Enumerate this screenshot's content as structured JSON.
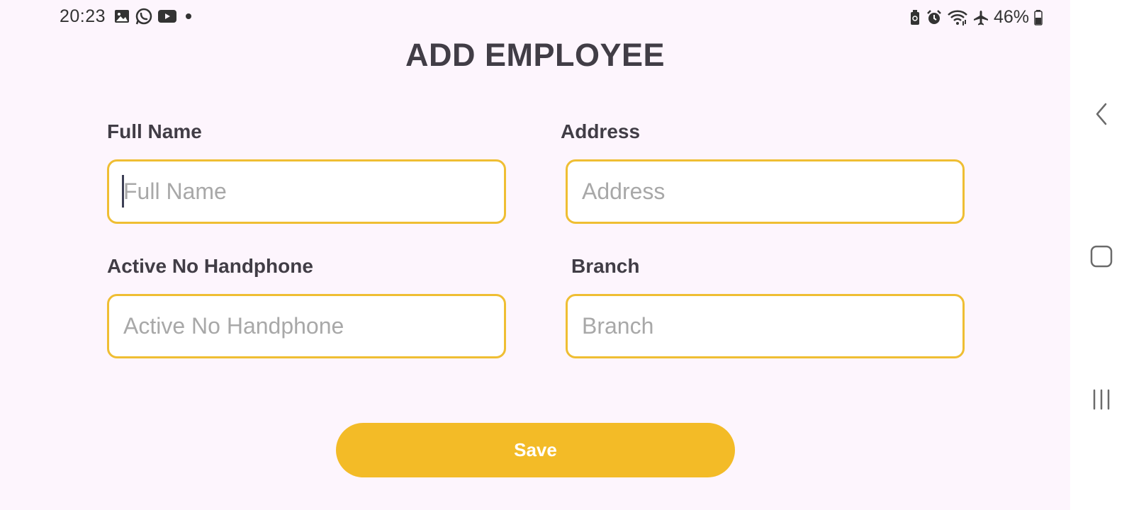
{
  "status_bar": {
    "time": "20:23",
    "left_icons": [
      "image-icon",
      "whatsapp-icon",
      "youtube-icon",
      "dot-icon"
    ],
    "right_icons": [
      "battery-saver-icon",
      "alarm-icon",
      "wifi-icon",
      "airplane-icon"
    ],
    "battery_percent": "46%"
  },
  "page": {
    "title": "ADD EMPLOYEE"
  },
  "form": {
    "full_name": {
      "label": "Full Name",
      "placeholder": "Full Name",
      "value": ""
    },
    "address": {
      "label": "Address",
      "placeholder": "Address",
      "value": ""
    },
    "phone": {
      "label": "Active No Handphone",
      "placeholder": "Active No Handphone",
      "value": ""
    },
    "branch": {
      "label": "Branch",
      "placeholder": "Branch",
      "value": ""
    },
    "save_label": "Save"
  },
  "nav_bar": {
    "buttons": [
      "back-icon",
      "home-icon",
      "recents-icon"
    ]
  },
  "colors": {
    "background": "#fdf5fd",
    "accent": "#f3bb27",
    "input_border": "#efbe33",
    "text_dark": "#413d46",
    "placeholder": "#a8a8a8"
  }
}
